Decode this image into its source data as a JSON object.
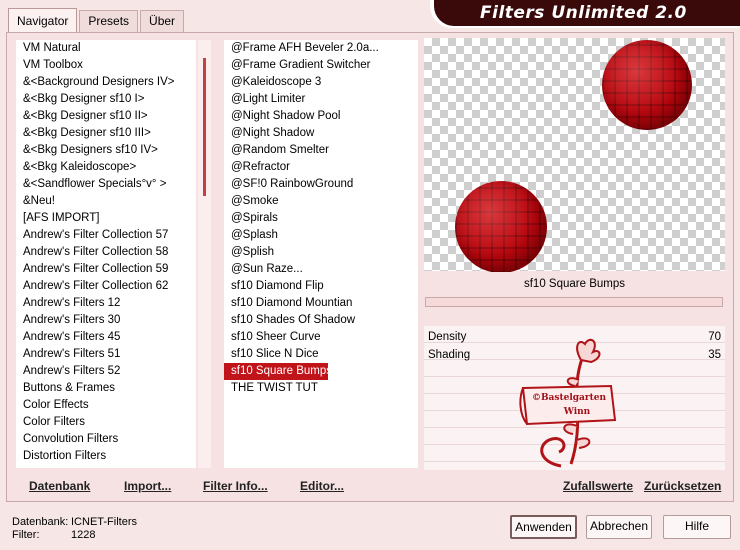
{
  "app": {
    "title": "Filters Unlimited 2.0"
  },
  "tabs": [
    "Navigator",
    "Presets",
    "Über"
  ],
  "categories": [
    "VM Natural",
    "VM Toolbox",
    "&<Background Designers IV>",
    "&<Bkg Designer sf10 I>",
    "&<Bkg Designer sf10 II>",
    "&<Bkg Designer sf10 III>",
    "&<Bkg Designers sf10 IV>",
    "&<Bkg Kaleidoscope>",
    "&<Sandflower Specials°v° >",
    "&Neu!",
    "[AFS IMPORT]",
    "Andrew's Filter Collection 57",
    "Andrew's Filter Collection 58",
    "Andrew's Filter Collection 59",
    "Andrew's Filter Collection 62",
    "Andrew's Filters 12",
    "Andrew's Filters 30",
    "Andrew's Filters 45",
    "Andrew's Filters 51",
    "Andrew's Filters 52",
    "Buttons & Frames",
    "Color Effects",
    "Color Filters",
    "Convolution Filters",
    "Distortion Filters"
  ],
  "filters": [
    "@Frame AFH Beveler 2.0a...",
    "@Frame Gradient Switcher",
    "@Kaleidoscope 3",
    "@Light Limiter",
    "@Night Shadow Pool",
    "@Night Shadow",
    "@Random Smelter",
    "@Refractor",
    "@SF!0 RainbowGround",
    "@Smoke",
    "@Spirals",
    "@Splash",
    "@Splish",
    "@Sun Raze...",
    "sf10 Diamond Flip",
    "sf10 Diamond Mountian",
    "sf10 Shades Of Shadow",
    "sf10 Sheer Curve",
    "sf10 Slice N Dice",
    "sf10 Square Bumps",
    "THE TWIST TUT"
  ],
  "selected_filter": "sf10 Square Bumps",
  "params": [
    {
      "label": "Density",
      "value": "70"
    },
    {
      "label": "Shading",
      "value": "35"
    }
  ],
  "watermark": {
    "line1": "©Bastelgarten",
    "line2": "Winn"
  },
  "toolbar": {
    "datenbank": "Datenbank",
    "import": "Import...",
    "filter_info": "Filter Info...",
    "editor": "Editor...",
    "random": "Zufallswerte",
    "reset": "Zurücksetzen"
  },
  "status": {
    "db_label": "Datenbank:",
    "db_value": "ICNET-Filters",
    "filter_label": "Filter:",
    "filter_value": "1228"
  },
  "buttons": {
    "apply": "Anwenden",
    "cancel": "Abbrechen",
    "help": "Hilfe"
  },
  "colors": {
    "accent": "#c0141a",
    "banner": "#3a0a0a",
    "background": "#f6e6e6"
  }
}
